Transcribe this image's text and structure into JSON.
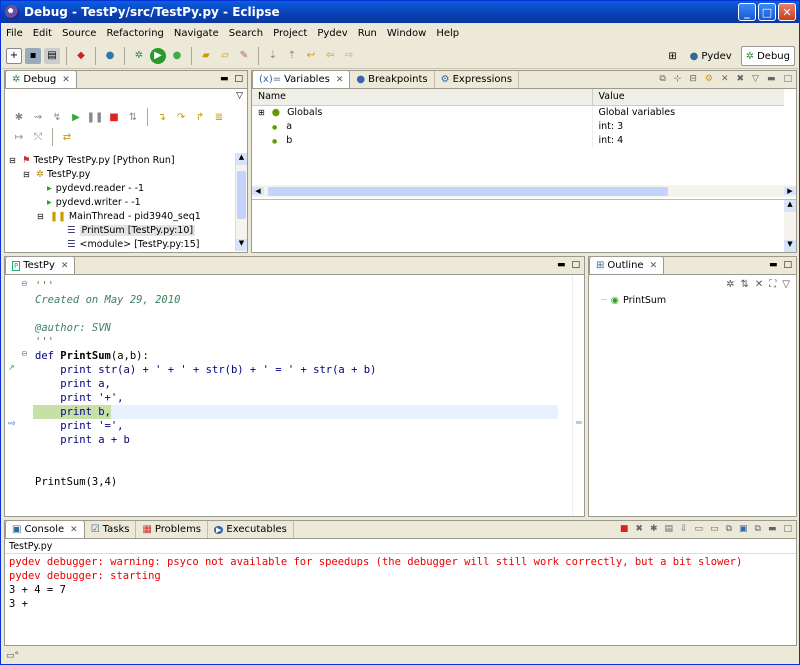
{
  "window": {
    "title": "Debug - TestPy/src/TestPy.py - Eclipse",
    "min": "_",
    "max": "□",
    "close": "✕"
  },
  "menu": [
    "File",
    "Edit",
    "Source",
    "Refactoring",
    "Navigate",
    "Search",
    "Project",
    "Pydev",
    "Run",
    "Window",
    "Help"
  ],
  "perspectives": {
    "pydev": "Pydev",
    "debug": "Debug"
  },
  "debug_view": {
    "tab": "Debug",
    "tree": [
      {
        "label": "TestPy TestPy.py [Python Run]",
        "indent": 0
      },
      {
        "label": "TestPy.py",
        "indent": 1
      },
      {
        "label": "pydevd.reader - -1",
        "indent": 2
      },
      {
        "label": "pydevd.writer - -1",
        "indent": 2
      },
      {
        "label": "MainThread - pid3940_seq1",
        "indent": 2
      },
      {
        "label": "PrintSum [TestPy.py:10]",
        "indent": 3
      },
      {
        "label": "<module> [TestPy.py:15]",
        "indent": 3
      }
    ]
  },
  "variables_view": {
    "tabs": [
      "Variables",
      "Breakpoints",
      "Expressions"
    ],
    "columns": [
      "Name",
      "Value"
    ],
    "rows": [
      {
        "name": "Globals",
        "value": "Global variables"
      },
      {
        "name": "a",
        "value": "int: 3"
      },
      {
        "name": "b",
        "value": "int: 4"
      }
    ]
  },
  "editor": {
    "tab": "TestPy",
    "lines": [
      {
        "kind": "comment",
        "text": "'''"
      },
      {
        "kind": "comment",
        "text": "Created on May 29, 2010"
      },
      {
        "kind": "blank",
        "text": ""
      },
      {
        "kind": "comment",
        "text": "@author: SVN"
      },
      {
        "kind": "comment",
        "text": "'''"
      },
      {
        "kind": "def",
        "kw": "def ",
        "name": "PrintSum",
        "rest": "(a,b):"
      },
      {
        "kind": "code",
        "text": "    print str(a) + ' + ' + str(b) + ' = ' + str(a + b)"
      },
      {
        "kind": "code",
        "text": "    print a,"
      },
      {
        "kind": "code",
        "text": "    print '+',"
      },
      {
        "kind": "current",
        "text": "    print b,"
      },
      {
        "kind": "code",
        "text": "    print '=',"
      },
      {
        "kind": "code",
        "text": "    print a + b"
      },
      {
        "kind": "blank",
        "text": ""
      },
      {
        "kind": "blank",
        "text": ""
      },
      {
        "kind": "code",
        "text": "PrintSum(3,4)"
      }
    ]
  },
  "outline": {
    "tab": "Outline",
    "items": [
      "PrintSum"
    ]
  },
  "console": {
    "tabs": [
      "Console",
      "Tasks",
      "Problems",
      "Executables"
    ],
    "process": "TestPy.py",
    "lines": [
      {
        "color": "red",
        "text": "pydev debugger: warning: psyco not available for speedups (the debugger will still work correctly, but a bit slower)"
      },
      {
        "color": "red",
        "text": "pydev debugger: starting"
      },
      {
        "color": "black",
        "text": "3 + 4 = 7"
      },
      {
        "color": "black",
        "text": "3 +"
      }
    ]
  },
  "statusbar": {
    "text": ""
  }
}
